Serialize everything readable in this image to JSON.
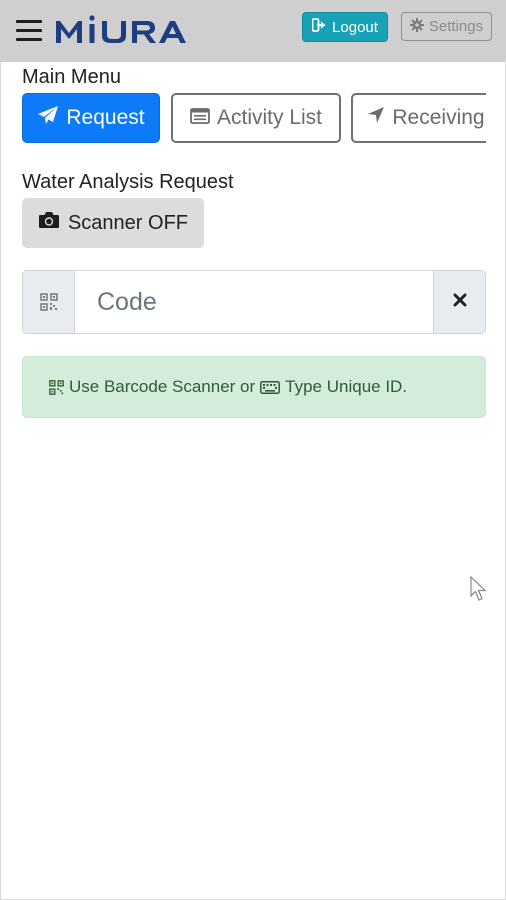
{
  "header": {
    "logo_text": "MIURA",
    "logout_label": "Logout",
    "settings_label": "Settings",
    "colors": {
      "bar": "#cfcfcf",
      "logo": "#1d3f80",
      "logout": "#17a2b8"
    }
  },
  "main_menu": {
    "label": "Main Menu",
    "tabs": [
      {
        "label": "Request",
        "icon": "paper-plane-icon",
        "active": true
      },
      {
        "label": "Activity List",
        "icon": "list-icon",
        "active": false
      },
      {
        "label": "Receiving",
        "icon": "location-arrow-icon",
        "active": false
      }
    ],
    "active_color": "#0d7bf7"
  },
  "request": {
    "title": "Water Analysis Request",
    "scanner_label": "Scanner OFF"
  },
  "code_input": {
    "placeholder": "Code",
    "value": ""
  },
  "alert": {
    "text_part1": "Use Barcode Scanner or",
    "text_part2": "Type Unique ID.",
    "color": "#d4edda"
  }
}
